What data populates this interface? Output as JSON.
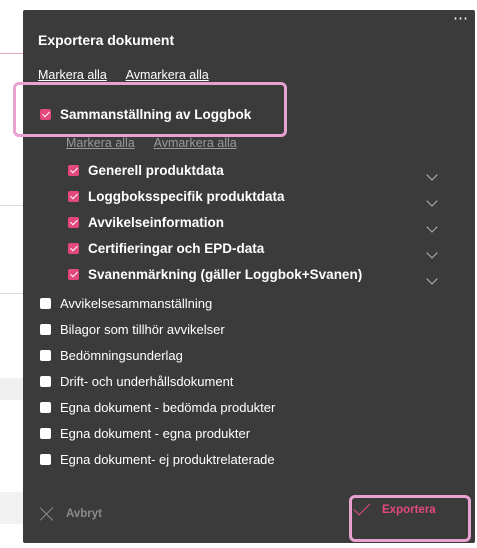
{
  "dialog": {
    "title": "Exportera dokument",
    "select_all": "Markera alla",
    "deselect_all": "Avmarkera alla",
    "group": {
      "label": "Sammanställning av Loggbok",
      "checked": true,
      "select_all": "Markera alla",
      "deselect_all": "Avmarkera alla",
      "items": [
        {
          "label": "Generell produktdata",
          "checked": true
        },
        {
          "label": "Loggboksspecifik produktdata",
          "checked": true
        },
        {
          "label": "Avvikelseinformation",
          "checked": true
        },
        {
          "label": "Certifieringar och EPD-data",
          "checked": true
        },
        {
          "label": "Svanenmärkning (gäller Loggbok+Svanen)",
          "checked": true
        }
      ]
    },
    "options": [
      {
        "label": "Avvikelsesammanställning",
        "checked": false
      },
      {
        "label": "Bilagor som tillhör avvikelser",
        "checked": false
      },
      {
        "label": "Bedömningsunderlag",
        "checked": false
      },
      {
        "label": "Drift- och underhållsdokument",
        "checked": false
      },
      {
        "label": "Egna dokument - bedömda produkter",
        "checked": false
      },
      {
        "label": "Egna dokument - egna produkter",
        "checked": false
      },
      {
        "label": "Egna dokument- ej produktrelaterade",
        "checked": false
      }
    ],
    "cancel_label": "Avbryt",
    "export_label": "Exportera",
    "more_icon": "⋯"
  },
  "colors": {
    "accent": "#e4487f",
    "dialog_bg": "#3b3b3b",
    "highlight": "#e9a2cf"
  }
}
